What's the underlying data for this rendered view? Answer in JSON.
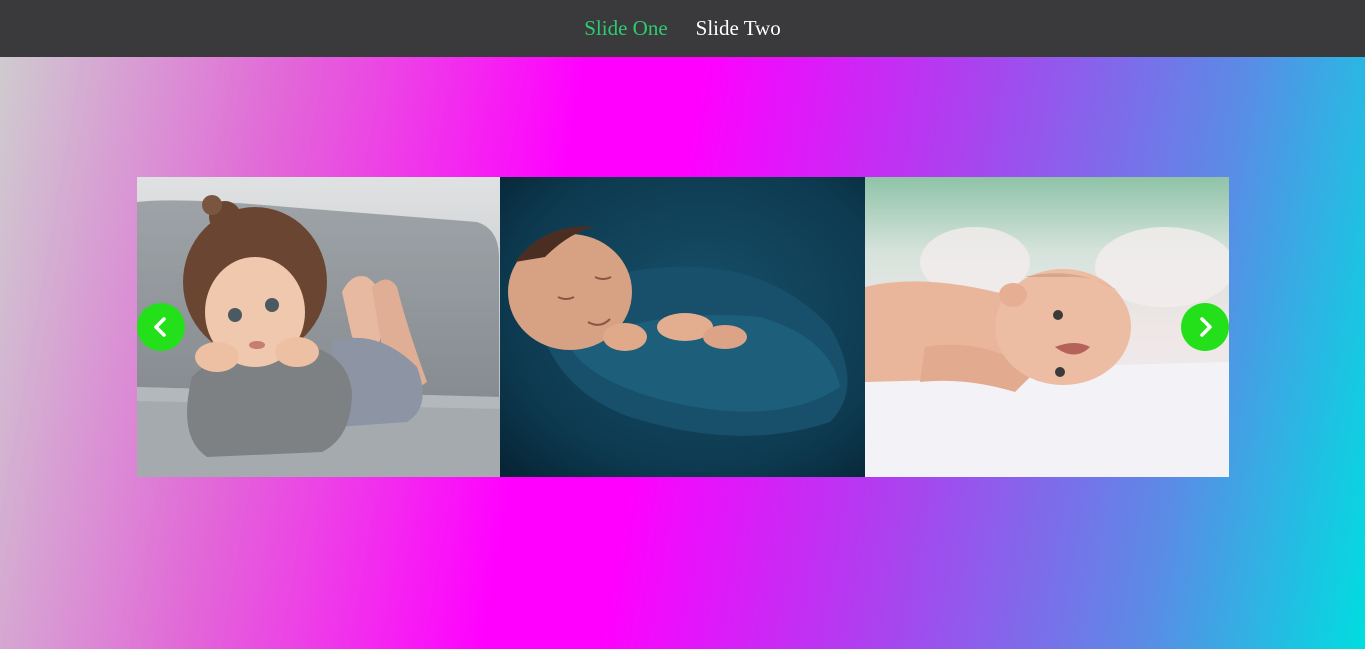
{
  "nav": {
    "items": [
      {
        "label": "Slide One",
        "active": true
      },
      {
        "label": "Slide Two",
        "active": false
      }
    ]
  },
  "slider": {
    "slides": [
      {
        "subject": "toddler-girl-on-sofa"
      },
      {
        "subject": "newborn-swaddled-teal"
      },
      {
        "subject": "smiling-baby-lying"
      }
    ],
    "prev_icon": "chevron-left-icon",
    "next_icon": "chevron-right-icon"
  },
  "colors": {
    "nav_bg": "#3a393b",
    "nav_active": "#2ecc71",
    "arrow_bg": "#24e01a"
  }
}
